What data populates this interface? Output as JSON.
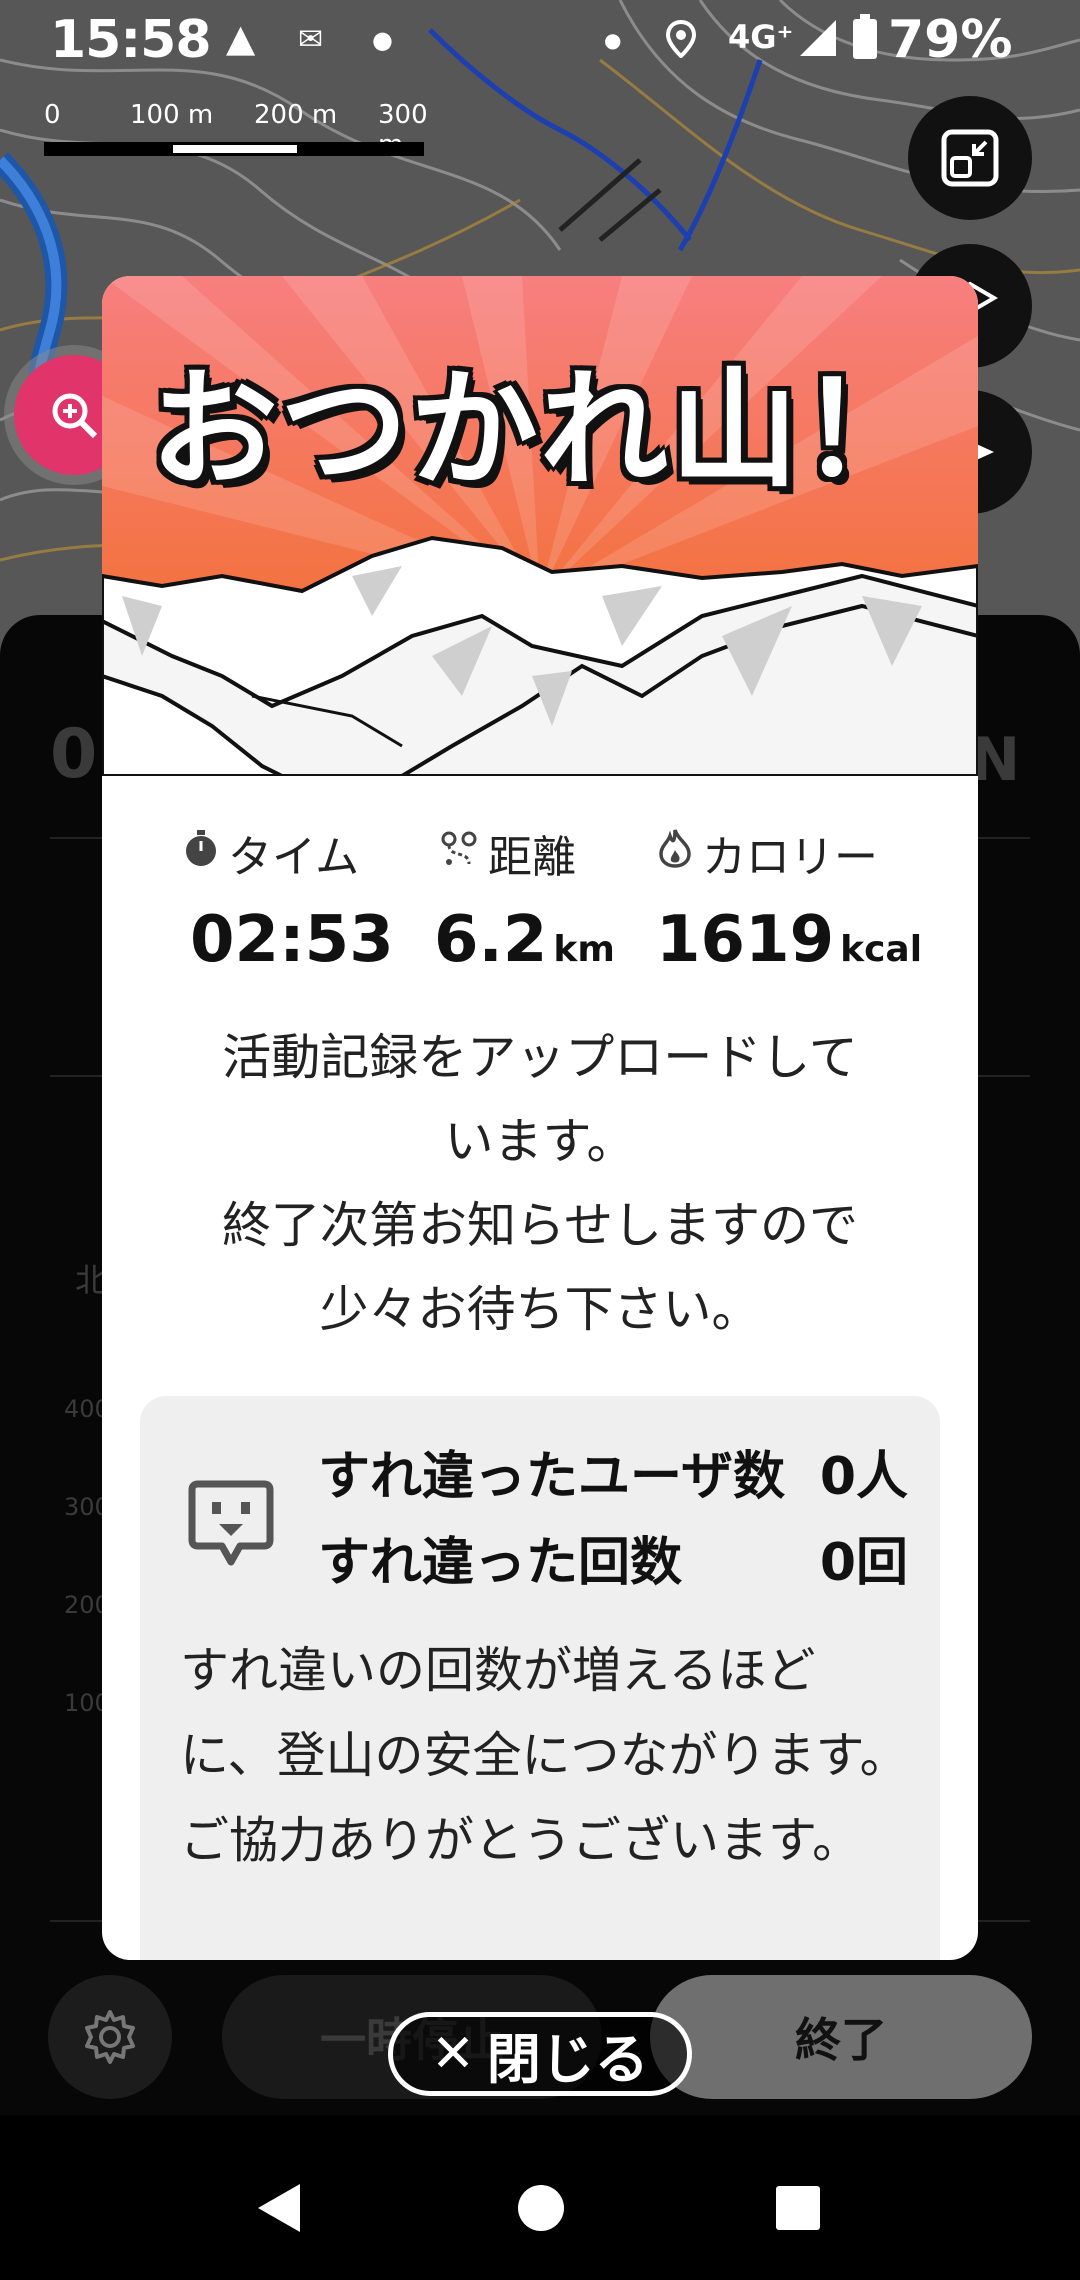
{
  "status_bar": {
    "time": "15:58",
    "network": "4G⁺",
    "battery": "79%"
  },
  "map": {
    "scale_labels": [
      "0",
      "100 m",
      "200 m",
      "300 m"
    ]
  },
  "background": {
    "elapsed_ghost": "02",
    "north_ghost": "N",
    "chart_ghost": "北",
    "axis_ghosts": [
      "400",
      "300",
      "200",
      "100"
    ]
  },
  "controls": {
    "pause_label": "一時停止",
    "end_label": "終了"
  },
  "modal": {
    "title": "おつかれ山！",
    "stats": {
      "time_label": "タイム",
      "time_value": "02:53",
      "distance_label": "距離",
      "distance_value": "6.2",
      "distance_unit": "km",
      "calorie_label": "カロリー",
      "calorie_value": "1619",
      "calorie_unit": "kcal"
    },
    "message_line1": "活動記録をアップロードして\nいます。",
    "message_line2": "終了次第お知らせしますので\n少々お待ち下さい。",
    "passing": {
      "users_label": "すれ違ったユーザ数",
      "users_value": "0人",
      "count_label": "すれ違った回数",
      "count_value": "0回",
      "description": "すれ違いの回数が増えるほどに、登山の安全につながります。ご協力ありがとうございます。"
    }
  },
  "close_button": {
    "label": "閉じる"
  },
  "colors": {
    "banner_top": "#f77f7f",
    "banner_bottom": "#f26b1d",
    "zoom_button": "#e0346a"
  }
}
